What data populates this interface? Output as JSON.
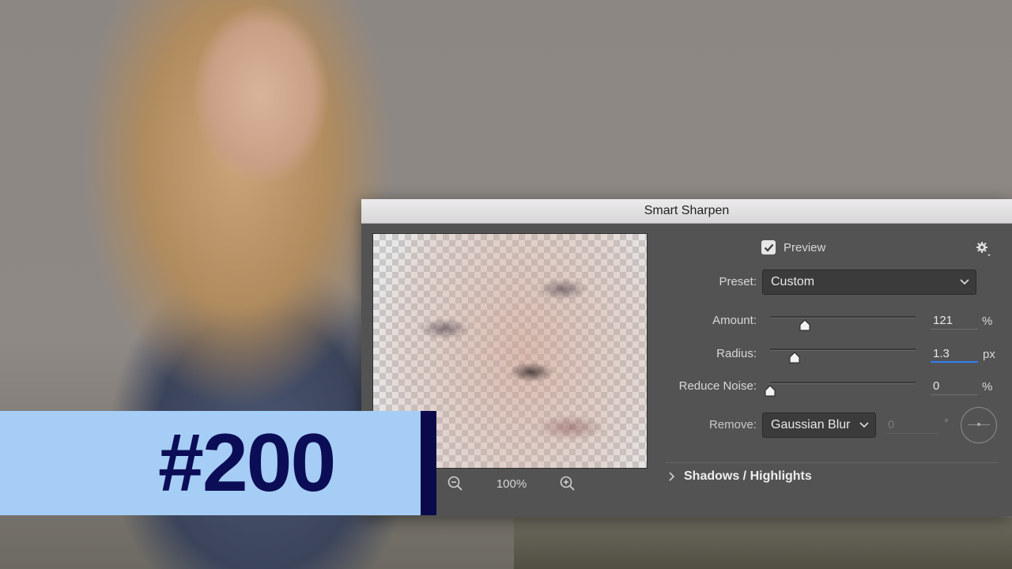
{
  "dialog": {
    "title": "Smart Sharpen",
    "preview_label": "Preview",
    "preview_checked": true,
    "zoom_level": "100%",
    "preset": {
      "label": "Preset:",
      "value": "Custom"
    },
    "amount": {
      "label": "Amount:",
      "value": "121",
      "unit": "%",
      "slider_fraction": 0.24
    },
    "radius": {
      "label": "Radius:",
      "value": "1.3",
      "unit": "px",
      "slider_fraction": 0.17
    },
    "reduce_noise": {
      "label": "Reduce Noise:",
      "value": "0",
      "unit": "%",
      "slider_fraction": 0.0
    },
    "remove": {
      "label": "Remove:",
      "value": "Gaussian Blur",
      "angle_value": "0",
      "angle_unit": "°"
    },
    "section_label": "Shadows / Highlights"
  },
  "badge": {
    "text": "#200"
  },
  "icons": [
    "gear-icon",
    "chevron-down-icon",
    "zoom-out-icon",
    "zoom-in-icon",
    "checkmark-icon",
    "chevron-right-icon"
  ],
  "colors": {
    "badge_bg": "#a6cdf5",
    "badge_text": "#0c0d57",
    "dialog_bg": "#535353",
    "focus_blue": "#2d7ff9"
  }
}
